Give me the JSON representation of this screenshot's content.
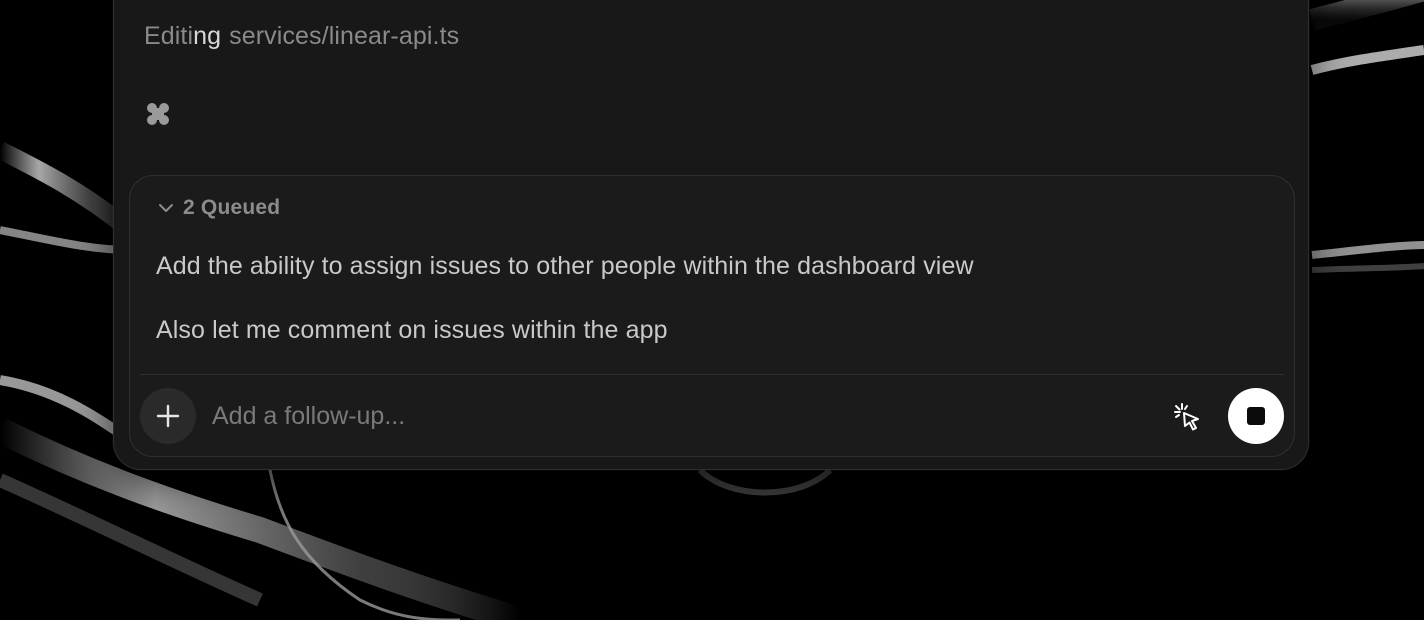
{
  "status": {
    "verb_dim": "Editi",
    "verb_bright": "ng",
    "file": "services/linear-api.ts",
    "spinner_icon": "dots-spinner-icon"
  },
  "queue": {
    "header_label": "2 Queued",
    "expanded": true,
    "items": [
      "Add the ability to assign issues to other people within the dashboard view",
      "Also let me comment on issues within the app"
    ]
  },
  "composer": {
    "placeholder": "Add a follow-up...",
    "value": "",
    "add_icon": "plus-icon",
    "cursor_icon": "cursor-click-icon",
    "stop_icon": "stop-icon"
  },
  "colors": {
    "panel_bg": "#181818",
    "composer_bg": "#1b1b1b",
    "text_primary": "#c9c9c9",
    "text_muted": "#8a8a8a",
    "stop_button_bg": "#ffffff"
  }
}
